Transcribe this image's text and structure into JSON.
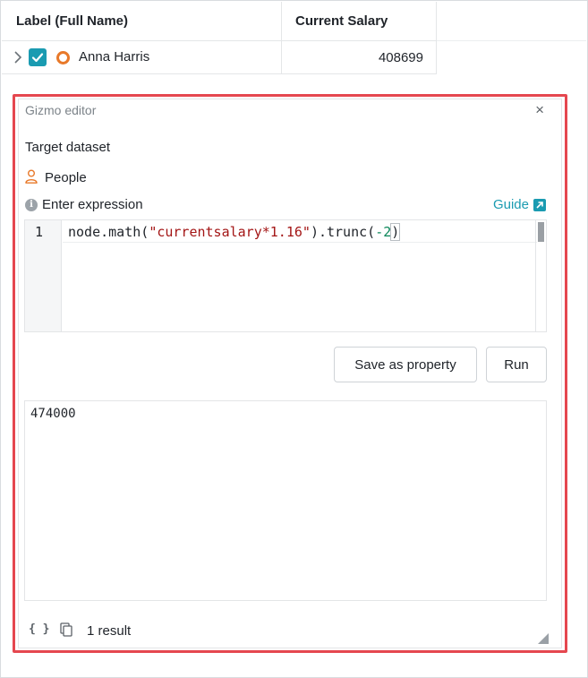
{
  "table": {
    "headers": [
      "Label (Full Name)",
      "Current Salary"
    ],
    "rows": [
      {
        "name": "Anna Harris",
        "salary": "408699",
        "checked": true
      }
    ]
  },
  "editor": {
    "title": "Gizmo editor",
    "close_glyph": "×",
    "target_label": "Target dataset",
    "dataset": "People",
    "expression_label": "Enter expression",
    "guide_label": "Guide",
    "line_number": "1",
    "code": {
      "prefix": "node.math(",
      "string": "\"currentsalary*1.16\"",
      "middle": ").trunc(",
      "arg": "-2",
      "suffix": ")"
    },
    "save_button": "Save as property",
    "run_button": "Run",
    "result_value": "474000",
    "footer_braces": "{ }",
    "result_count": "1 result"
  },
  "colors": {
    "accent": "#1a9bb1",
    "node_orange": "#e8792a",
    "highlight_red": "#e5474f"
  }
}
